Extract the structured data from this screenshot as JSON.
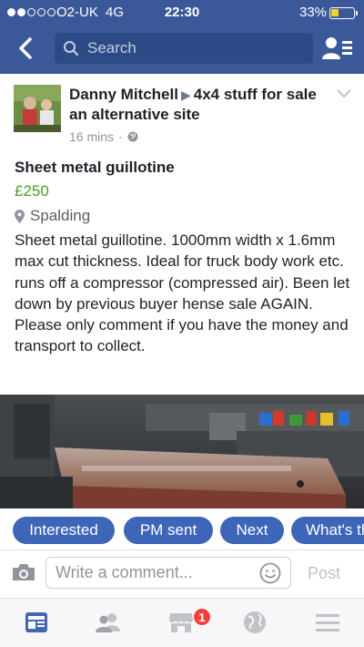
{
  "status_bar": {
    "carrier": "O2-UK",
    "network": "4G",
    "time": "22:30",
    "battery_percent": "33%",
    "battery_level": 0.33,
    "signal_bars": 2
  },
  "nav": {
    "search_placeholder": "Search",
    "back_icon": "back-chevron-icon",
    "friends_icon": "friend-list-icon"
  },
  "post": {
    "author": "Danny Mitchell",
    "group": "4x4 stuff for sale an alternative site",
    "timestamp": "16 mins",
    "privacy_icon": "globe-icon",
    "title": "Sheet metal guillotine",
    "price": "£250",
    "location": "Spalding",
    "description": "Sheet metal guillotine. 1000mm width x 1.6mm max cut thickness. Ideal for truck body work etc. runs off a compressor (compressed air). Been let down by previous buyer hense sale AGAIN. Please only comment if you have the money and transport to collect."
  },
  "replies": [
    "Interested",
    "PM sent",
    "Next",
    "What's the lowest price?"
  ],
  "comment_bar": {
    "placeholder": "Write a comment...",
    "post_label": "Post"
  },
  "tab_bar": {
    "marketplace_badge": "1"
  },
  "colors": {
    "brand": "#3b5998",
    "price": "#4a9b24",
    "chip": "#3e66b8",
    "badge": "#fa3e3e"
  }
}
